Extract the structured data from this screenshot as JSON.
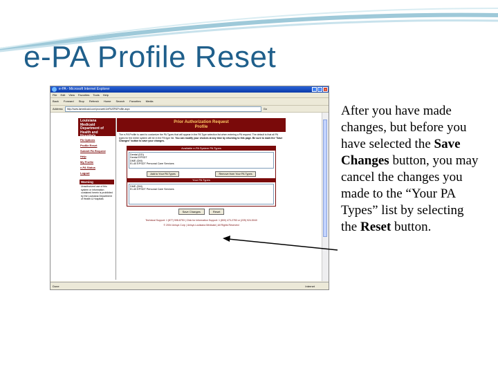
{
  "slide": {
    "title": "e-PA Profile Reset",
    "caption_parts": [
      "After you have made changes, but before you have selected the ",
      "Save Changes",
      " button, you may cancel the changes you made to the “Your PA Types” list by selecting the ",
      "Reset",
      " button."
    ]
  },
  "browser": {
    "window_title": "e-PA - Microsoft Internet Explorer",
    "menu": [
      "File",
      "Edit",
      "View",
      "Favorites",
      "Tools",
      "Help"
    ],
    "toolbar": [
      "Back",
      "Forward",
      "Stop",
      "Refresh",
      "Home",
      "Search",
      "Favorites",
      "Media"
    ],
    "address_label": "Address",
    "address_value": "http://www.lamedicaid.com/provweb1/ePA/EPAProfile.aspx",
    "go_label": "Go",
    "status_left": "Done",
    "status_zone": "Internet"
  },
  "site": {
    "logo_lines": [
      "Louisiana",
      "Medicaid",
      "Department of",
      "Health and Hospitals"
    ],
    "nav": [
      "PA Options",
      "Profile Reset",
      "Submit PA Request",
      "Help",
      "My Profile",
      "e-PA Status",
      "Logout"
    ],
    "warning_title": "Warning",
    "warning_text": "Unauthorized use of this system or information contained herein is prohibited by the Louisiana Department of Health & Hospitals",
    "header_line1": "Prior Authorization Request",
    "header_line2": "Profile",
    "intro_text": "The e-PA Profile is used to customize the PA Types that will appear in the PA Type selection list when entering a PA request. The default is that all PA types for the entire system will be in the PA type list.",
    "intro_bold": "You can modify your choices at any time by returning to this page. Be sure to mark the \"Save Changes\" button to save your changes.",
    "available_header": "Available e-PA System PA Types",
    "available_list": [
      "Dental (DD)",
      "Dental EPSDT",
      "DME (DM)",
      "EI-40 EPSDT Personal Care Services"
    ],
    "add_button": "Add to Your PA Types",
    "remove_button": "Remove from Your PA Types",
    "your_header": "Your PA Types",
    "your_list": [
      "DME (DM)",
      "EI-40 EPSDT Personal Care Services"
    ],
    "save_button": "Save Changes",
    "reset_button": "Reset",
    "footer1": "Technical Support: 1 (877) 598-8753 | Click for Information Support: 1 (800) 473-2783 or (225) 924-5040",
    "footer2": "© 2004 Unisys Corp | Unisys Louisiana Medicaid | All Rights Reserved"
  },
  "colors": {
    "title_blue": "#1f5f8b",
    "site_maroon": "#7a0a0a"
  }
}
